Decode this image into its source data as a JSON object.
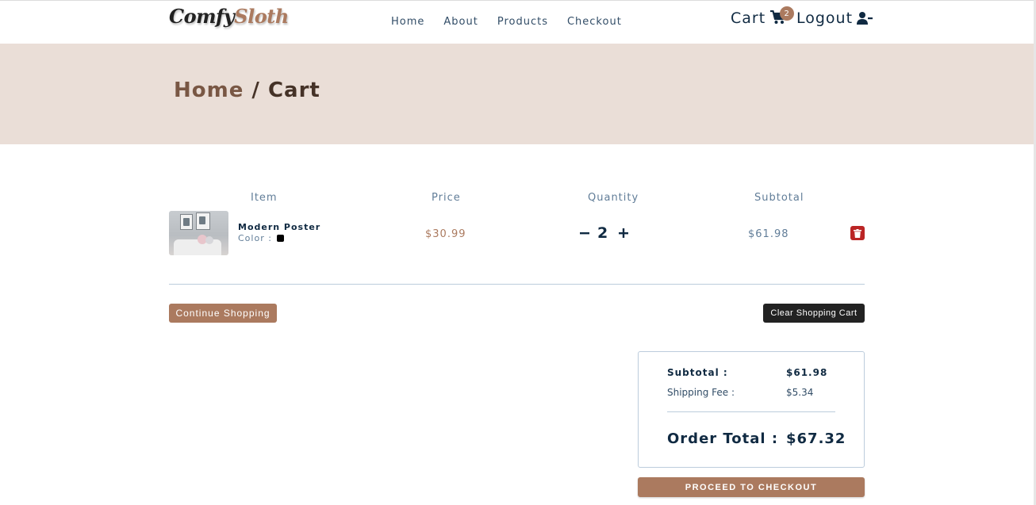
{
  "brand": {
    "logo_part1": "Comfy",
    "logo_part2": "Sloth"
  },
  "nav": {
    "links": [
      {
        "label": "Home"
      },
      {
        "label": "About"
      },
      {
        "label": "Products"
      },
      {
        "label": "Checkout"
      }
    ],
    "cart_label": "Cart",
    "cart_count": "2",
    "logout_label": "Logout"
  },
  "hero": {
    "crumb_home": "Home",
    "separator": " / ",
    "crumb_current": "Cart"
  },
  "cart": {
    "columns": {
      "item": "Item",
      "price": "Price",
      "quantity": "Quantity",
      "subtotal": "Subtotal"
    },
    "items": [
      {
        "name": "Modern Poster",
        "color_label": "Color :",
        "color_hex": "#000000",
        "price": "$30.99",
        "quantity": "2",
        "subtotal": "$61.98"
      }
    ],
    "continue_label": "Continue Shopping",
    "clear_label": "Clear Shopping Cart"
  },
  "totals": {
    "subtotal_label": "Subtotal :",
    "subtotal_value": "$61.98",
    "shipping_label": "Shipping Fee :",
    "shipping_value": "$5.34",
    "order_total_label": "Order Total :",
    "order_total_value": "$67.32"
  },
  "checkout_label": "PROCEED TO CHECKOUT",
  "colors": {
    "primary": "#ab7a5f",
    "hero_bg": "#eaded7",
    "text_dark": "#102a42",
    "danger": "#bb2525",
    "black_button": "#222222"
  },
  "icons": [
    "cart-icon",
    "user-minus-icon",
    "trash-icon",
    "minus-icon",
    "plus-icon"
  ]
}
